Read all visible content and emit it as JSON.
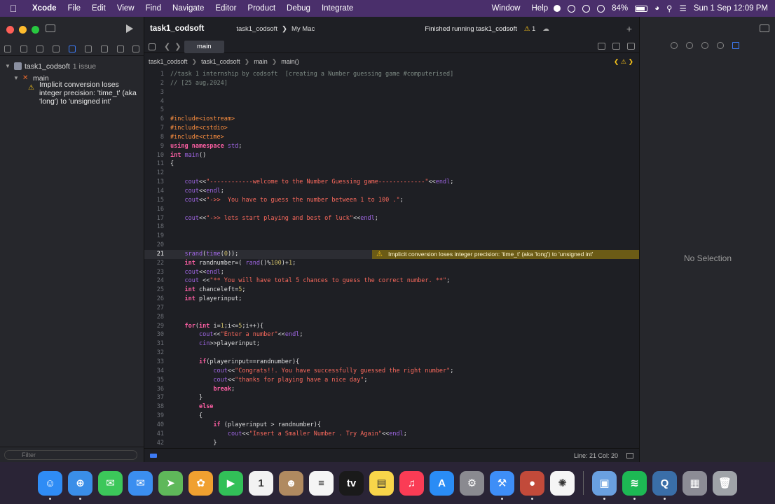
{
  "menubar": {
    "apple": "",
    "app": "Xcode",
    "items": [
      "File",
      "Edit",
      "View",
      "Find",
      "Navigate",
      "Editor",
      "Product",
      "Debug",
      "Integrate"
    ],
    "right_items": [
      "Window",
      "Help"
    ],
    "battery": "84%",
    "datetime": "Sun 1 Sep  12:09 PM"
  },
  "navigator": {
    "project": "task1_codsoft",
    "issue_count": "1 issue",
    "file": "main",
    "issue": "Implicit conversion loses integer precision: 'time_t' (aka 'long') to 'unsigned int'",
    "filter_placeholder": "Filter"
  },
  "toolbar": {
    "project_title": "task1_codsoft",
    "scheme": "task1_codsoft",
    "destination": "My Mac",
    "activity": "Finished running task1_codsoft",
    "warning_count": "1"
  },
  "tab": {
    "label": "main"
  },
  "jumpbar": {
    "items": [
      "task1_codsoft",
      "task1_codsoft",
      "main",
      "main()"
    ]
  },
  "warning_banner": "Implicit conversion loses integer precision: 'time_t' (aka 'long') to 'unsigned int'",
  "code": [
    {
      "n": "1",
      "t": "//task 1 internship by codsoft  [creating a Number guessing game #computerised]"
    },
    {
      "n": "2",
      "t": "// [25 aug,2024]"
    },
    {
      "n": "3",
      "t": ""
    },
    {
      "n": "4",
      "t": ""
    },
    {
      "n": "5",
      "t": ""
    },
    {
      "n": "6",
      "t": "#include<iostream>"
    },
    {
      "n": "7",
      "t": "#include<cstdio>"
    },
    {
      "n": "8",
      "t": "#include<ctime>"
    },
    {
      "n": "9",
      "t": "using namespace std;"
    },
    {
      "n": "10",
      "t": "int main()"
    },
    {
      "n": "11",
      "t": "{"
    },
    {
      "n": "12",
      "t": ""
    },
    {
      "n": "13",
      "t": "    cout<<\"------------welcome to the Number Guessing game-------------\"<<endl;"
    },
    {
      "n": "14",
      "t": "    cout<<endl;"
    },
    {
      "n": "15",
      "t": "    cout<<\"->>  You have to guess the number between 1 to 100 .\";"
    },
    {
      "n": "16",
      "t": ""
    },
    {
      "n": "17",
      "t": "    cout<<\"->> lets start playing and best of luck\"<<endl;"
    },
    {
      "n": "18",
      "t": ""
    },
    {
      "n": "19",
      "t": ""
    },
    {
      "n": "20",
      "t": ""
    },
    {
      "n": "21",
      "t": "    srand(time(0));"
    },
    {
      "n": "22",
      "t": "    int randnumber=( rand()%100)+1;"
    },
    {
      "n": "23",
      "t": "    cout<<endl;"
    },
    {
      "n": "24",
      "t": "    cout <<\"** You will have total 5 chances to guess the correct number. **\";"
    },
    {
      "n": "25",
      "t": "    int chanceleft=5;"
    },
    {
      "n": "26",
      "t": "    int playerinput;"
    },
    {
      "n": "27",
      "t": ""
    },
    {
      "n": "28",
      "t": ""
    },
    {
      "n": "29",
      "t": "    for(int i=1;i<=5;i++){"
    },
    {
      "n": "30",
      "t": "        cout<<\"Enter a number\"<<endl;"
    },
    {
      "n": "31",
      "t": "        cin>>playerinput;"
    },
    {
      "n": "32",
      "t": ""
    },
    {
      "n": "33",
      "t": "        if(playerinput==randnumber){"
    },
    {
      "n": "34",
      "t": "            cout<<\"Congrats!!. You have successfully guessed the right number\";"
    },
    {
      "n": "35",
      "t": "            cout<<\"thanks for playing have a nice day\";"
    },
    {
      "n": "36",
      "t": "            break;"
    },
    {
      "n": "37",
      "t": "        }"
    },
    {
      "n": "38",
      "t": "        else"
    },
    {
      "n": "39",
      "t": "        {"
    },
    {
      "n": "40",
      "t": "            if (playerinput > randnumber){"
    },
    {
      "n": "41",
      "t": "                cout<<\"Insert a Smaller Number . Try Again\"<<endl;"
    },
    {
      "n": "42",
      "t": "            }"
    }
  ],
  "status_bar": {
    "position": "Line: 21  Col: 20"
  },
  "inspector": {
    "empty_text": "No Selection"
  },
  "dock": {
    "apps": [
      {
        "name": "Finder",
        "glyph": "☺",
        "color": "#2f8cf5"
      },
      {
        "name": "Safari",
        "glyph": "⊕",
        "color": "#3a8ee8"
      },
      {
        "name": "Messages",
        "glyph": "✉",
        "color": "#3cc75a"
      },
      {
        "name": "Mail",
        "glyph": "✉",
        "color": "#3b8ef0"
      },
      {
        "name": "Maps",
        "glyph": "➤",
        "color": "#5fb85a"
      },
      {
        "name": "Photos",
        "glyph": "✿",
        "color": "#f0a030"
      },
      {
        "name": "FaceTime",
        "glyph": "▶",
        "color": "#32c058"
      },
      {
        "name": "Calendar",
        "glyph": "1",
        "color": "#f2f2f2"
      },
      {
        "name": "Contacts",
        "glyph": "☻",
        "color": "#b08a60"
      },
      {
        "name": "Reminders",
        "glyph": "≡",
        "color": "#f5f5f5"
      },
      {
        "name": "TV",
        "glyph": "tv",
        "color": "#1a1a1a"
      },
      {
        "name": "Notes",
        "glyph": "▤",
        "color": "#f8d54a"
      },
      {
        "name": "Music",
        "glyph": "♫",
        "color": "#fa3c55"
      },
      {
        "name": "App Store",
        "glyph": "A",
        "color": "#2a8cf5"
      },
      {
        "name": "System Settings",
        "glyph": "⚙",
        "color": "#8a8a90"
      },
      {
        "name": "Xcode",
        "glyph": "⚒",
        "color": "#3e8ef7"
      },
      {
        "name": "Launcher",
        "glyph": "●",
        "color": "#c24a3a"
      },
      {
        "name": "ChatGPT",
        "glyph": "✺",
        "color": "#f5f5f5"
      },
      {
        "name": "Preview",
        "glyph": "▣",
        "color": "#6aa0e0"
      },
      {
        "name": "Spotify",
        "glyph": "≋",
        "color": "#1db954"
      },
      {
        "name": "QuickTime",
        "glyph": "Q",
        "color": "#3a6ea8"
      },
      {
        "name": "Screenshots",
        "glyph": "▦",
        "color": "#8c8c95"
      },
      {
        "name": "Trash",
        "glyph": "🗑",
        "color": "#9fa3a8"
      }
    ]
  }
}
